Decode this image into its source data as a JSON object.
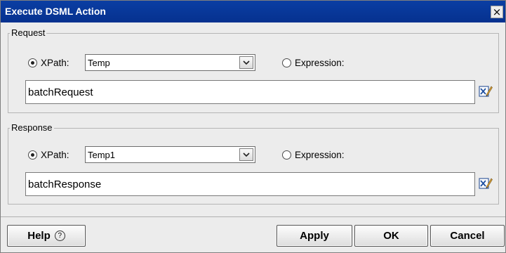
{
  "window": {
    "title": "Execute DSML Action",
    "close_glyph": "×"
  },
  "request": {
    "legend": "Request",
    "xpath_label": "XPath:",
    "xpath_value": "Temp",
    "expression_label": "Expression:",
    "field_value": "batchRequest"
  },
  "response": {
    "legend": "Response",
    "xpath_label": "XPath:",
    "xpath_value": "Temp1",
    "expression_label": "Expression:",
    "field_value": "batchResponse"
  },
  "footer": {
    "help_label": "Help",
    "help_icon": "?",
    "apply_label": "Apply",
    "ok_label": "OK",
    "cancel_label": "Cancel"
  },
  "icons": {
    "combo_arrow": "chevron-down-icon",
    "edit": "expression-editor-icon"
  },
  "colors": {
    "titlebar": "#06318f",
    "dialog_bg": "#ececec"
  }
}
